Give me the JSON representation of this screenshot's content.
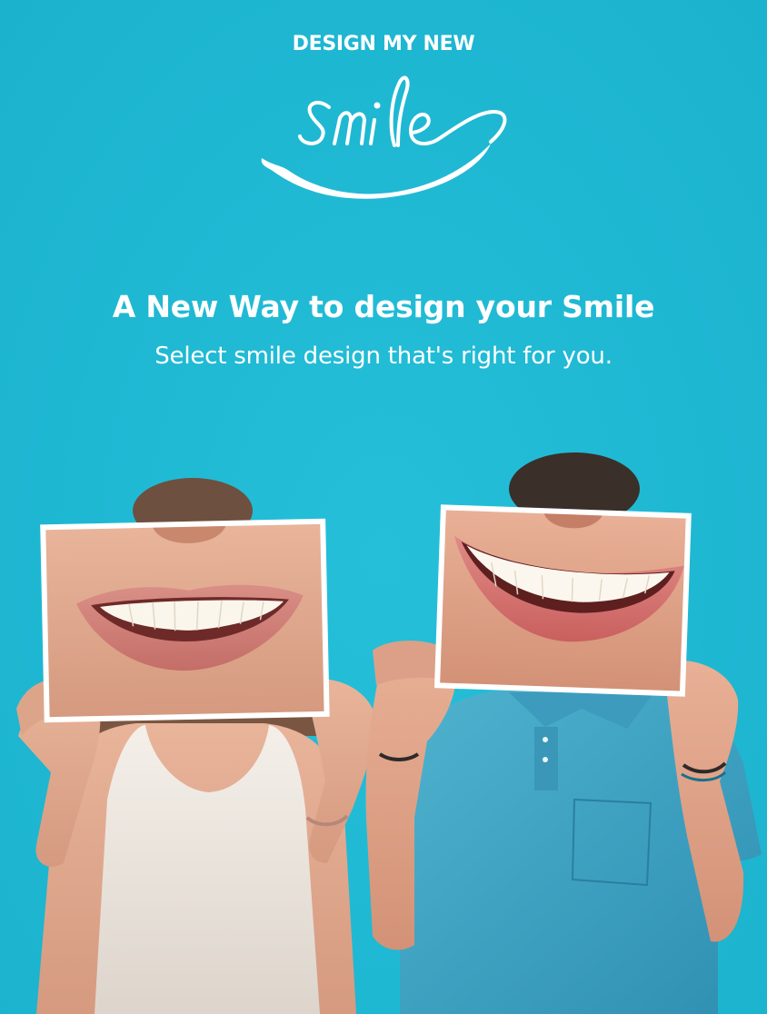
{
  "logo": {
    "top_text": "DESIGN MY NEW",
    "script_text": "smile"
  },
  "hero": {
    "headline": "A New Way to design your Smile",
    "subheadline": "Select smile design that's right for you."
  },
  "photo": {
    "description_icon": "couple-holding-smile-photos-image"
  },
  "colors": {
    "background": "#1fb8d3",
    "text": "#ffffff"
  }
}
